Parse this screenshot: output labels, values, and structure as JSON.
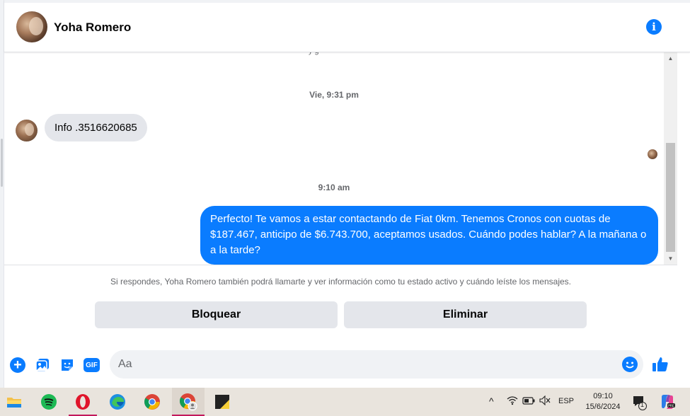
{
  "header": {
    "contact_name": "Yoha Romero"
  },
  "messages": {
    "faint_top_text": "y       g",
    "timestamp_1": "Vie, 9:31 pm",
    "incoming_text": "Info .3516620685",
    "timestamp_2": "9:10 am",
    "outgoing_text": "Perfecto! Te vamos a estar contactando de Fiat 0km. Tenemos Cronos con cuotas de $187.467, anticipo de $6.743.700, aceptamos usados. Cuándo podes hablar? A la mañana o a la tarde?"
  },
  "block_bar": {
    "notice": "Si respondes, Yoha Romero también podrá llamarte y ver información como tu estado activo y cuándo leíste los mensajes.",
    "block_label": "Bloquear",
    "delete_label": "Eliminar"
  },
  "composer": {
    "placeholder": "Aa",
    "gif_label": "GIF"
  },
  "taskbar": {
    "language": "ESP",
    "time": "09:10",
    "date": "15/6/2024",
    "notification_count": "1"
  },
  "colors": {
    "accent": "#0a7cff",
    "incoming_bubble": "#e4e6eb",
    "taskbar": "#e9e4dd"
  }
}
